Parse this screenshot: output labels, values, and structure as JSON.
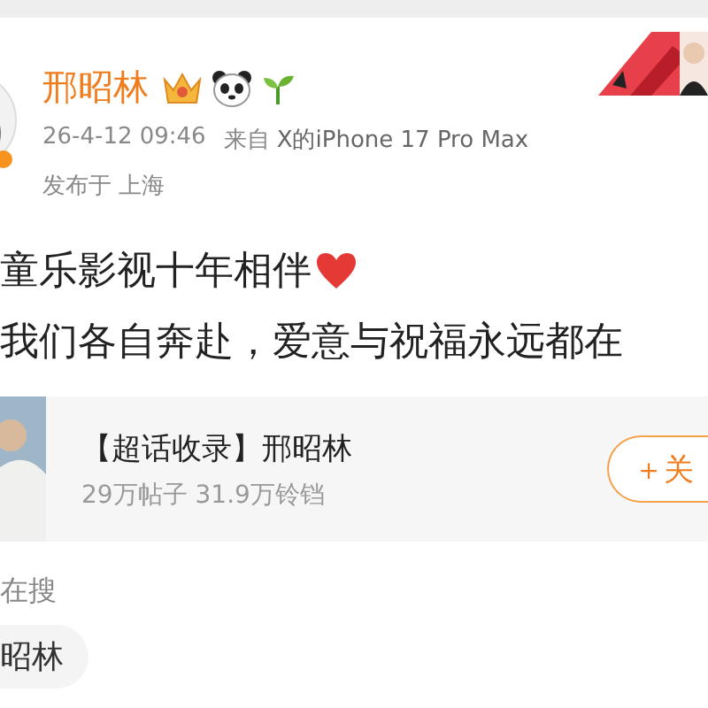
{
  "post": {
    "author": {
      "name": "邢昭林"
    },
    "time": "26-4-12 09:46",
    "source_prefix": "来自",
    "source": "X的iPhone 17 Pro Max",
    "location": "发布于 上海",
    "lines": [
      "童乐影视十年相伴",
      "我们各自奔赴，爱意与祝福永远都在"
    ]
  },
  "supertopic_card": {
    "title": "【超话收录】邢昭林",
    "stats": "29万帖子 31.9万铃铛",
    "follow_button": "＋关"
  },
  "trending": {
    "heading": "在搜",
    "chips": [
      "昭林"
    ]
  }
}
